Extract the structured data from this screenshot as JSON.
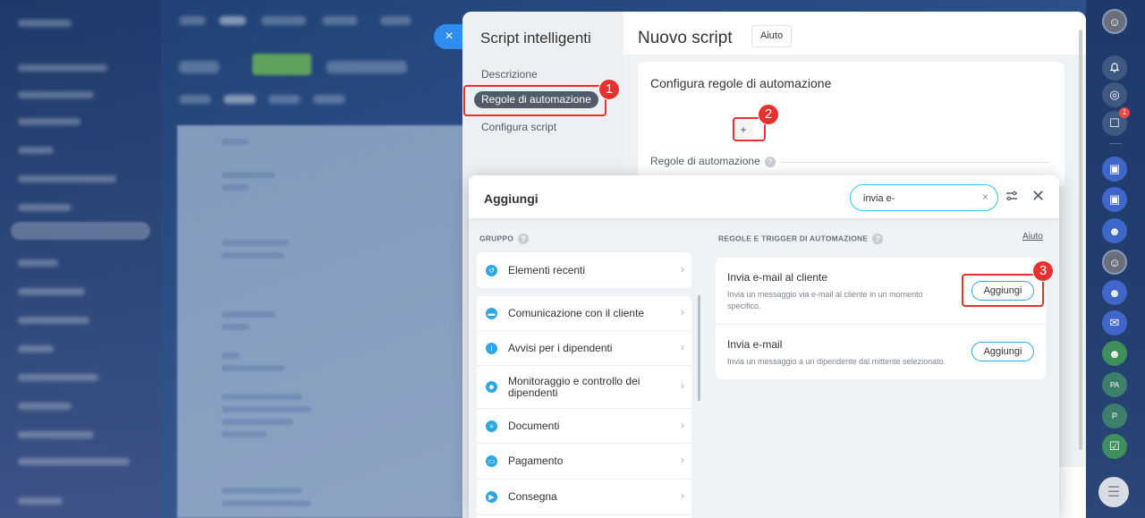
{
  "slider": {
    "title": "Script intelligenti",
    "close_symbol": "×",
    "nav": {
      "descrizione": "Descrizione",
      "regole": "Regole di automazione",
      "configura": "Configura script"
    },
    "header": {
      "title": "Nuovo script",
      "help": "Aiuto"
    },
    "card": {
      "title": "Configura regole di automazione",
      "add_symbol": "+",
      "rules_label": "Regole di automazione",
      "help_symbol": "?"
    }
  },
  "popup": {
    "title": "Aggiungi",
    "search": {
      "value": "invia e-",
      "clear_symbol": "×"
    },
    "close_symbol": "✕",
    "group_label": "GRUPPO",
    "rules_label": "REGOLE E TRIGGER DI AUTOMAZIONE",
    "help_link": "Aiuto",
    "help_symbol": "?",
    "groups": {
      "recent": "Elementi recenti",
      "items": [
        "Comunicazione con il cliente",
        "Avvisi per i dipendenti",
        "Monitoraggio e controllo dei dipendenti",
        "Documenti",
        "Pagamento",
        "Consegna"
      ]
    },
    "rules": [
      {
        "title": "Invia e-mail al cliente",
        "description": "Invia un messaggio via e-mail al cliente in un momento specifico.",
        "button": "Aggiungi"
      },
      {
        "title": "Invia e-mail",
        "description": "Invia un messaggio a un dipendente dal mittente selezionato.",
        "button": "Aggiungi"
      }
    ]
  },
  "callouts": [
    "1",
    "2",
    "3"
  ],
  "rightbar": {
    "notification_count": "1",
    "initials_pa": "PA",
    "initials_p": "P"
  },
  "colors": {
    "accent": "#2fc6f6",
    "callout_red": "#e8312f",
    "slider_close": "#2f8cf1",
    "nav_active": "#525c69"
  },
  "icons": [
    "close-icon",
    "search-clear-icon",
    "filter-icon",
    "history-icon",
    "chat-icon",
    "info-icon",
    "people-icon",
    "document-icon",
    "wallet-icon",
    "truck-icon",
    "chevron-right-icon",
    "bell-icon",
    "menu-icon"
  ]
}
